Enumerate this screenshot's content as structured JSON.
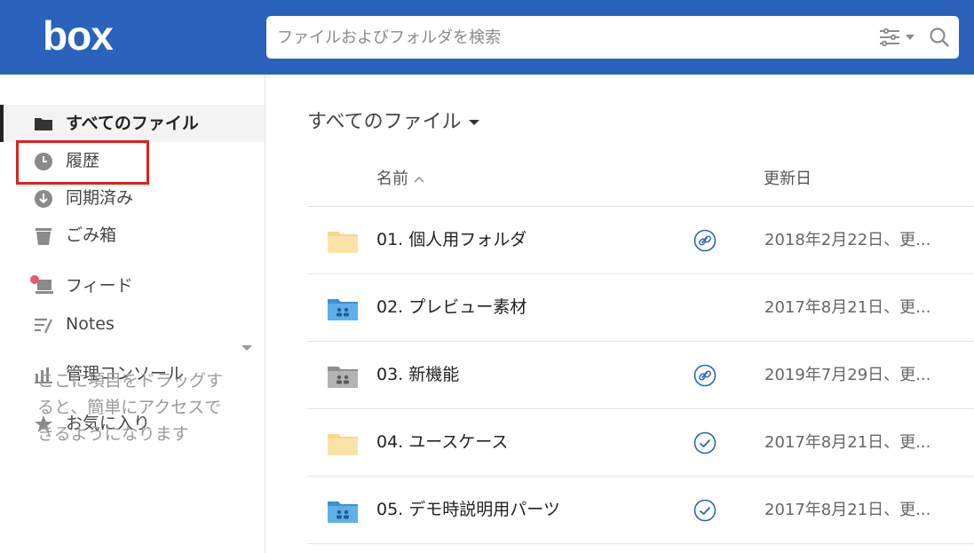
{
  "header": {
    "logo": "box",
    "search_placeholder": "ファイルおよびフォルダを検索",
    "brand_color": "#2a62bc"
  },
  "sidebar": {
    "items": [
      {
        "label": "すべてのファイル",
        "icon": "folder-icon",
        "active": true
      },
      {
        "label": "履歴",
        "icon": "clock-icon"
      },
      {
        "label": "同期済み",
        "icon": "sync-download-icon"
      },
      {
        "label": "ごみ箱",
        "icon": "trash-icon"
      },
      {
        "label": "フィード",
        "icon": "feed-icon",
        "badge_color": "#e8566b"
      },
      {
        "label": "Notes",
        "icon": "notes-icon"
      },
      {
        "label": "管理コンソール",
        "icon": "bar-chart-icon"
      },
      {
        "label": "お気に入り",
        "icon": "star-icon"
      }
    ],
    "favorites_hint": "ここに項目をドラッグすると、簡単にアクセスできるようになります"
  },
  "main": {
    "title": "すべてのファイル",
    "columns": {
      "name": "名前",
      "updated": "更新日"
    },
    "rows": [
      {
        "name": "01. 個人用フォルダ",
        "date": "2018年2月22日、更...",
        "folder_type": "personal",
        "status": "shared-link-icon"
      },
      {
        "name": "02. プレビュー素材",
        "date": "2017年8月21日、更...",
        "folder_type": "collab",
        "status": ""
      },
      {
        "name": "03. 新機能",
        "date": "2019年7月29日、更...",
        "folder_type": "collab-gray",
        "status": "shared-link-icon"
      },
      {
        "name": "04. ユースケース",
        "date": "2017年8月21日、更...",
        "folder_type": "personal",
        "status": "synced-check-icon"
      },
      {
        "name": "05. デモ時説明用パーツ",
        "date": "2017年8月21日、更...",
        "folder_type": "collab",
        "status": "synced-check-icon"
      }
    ]
  },
  "colors": {
    "accent_blue": "#2a62bc",
    "link_icon_blue": "#2a62bc",
    "folder_yellow": "#f5d98b",
    "folder_blue": "#4aa3df",
    "folder_gray": "#9b9b9b",
    "highlight_red": "#e0201c"
  }
}
